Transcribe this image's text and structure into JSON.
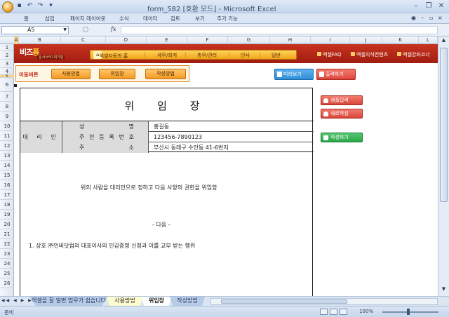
{
  "window": {
    "title": "form_582  [호환 모드] - Microsoft Excel"
  },
  "ribbon_tabs": [
    "홈",
    "삽입",
    "페이지 레이아웃",
    "수식",
    "데이터",
    "검토",
    "보기",
    "추가 기능"
  ],
  "formula_bar": {
    "name_box": "A5",
    "fx": "fx",
    "formula": ""
  },
  "columns": [
    "A",
    "B",
    "C",
    "D",
    "E",
    "F",
    "G",
    "H",
    "I",
    "J",
    "K",
    "L"
  ],
  "rows": [
    "1",
    "2",
    "3",
    "4",
    "5",
    "6",
    "7",
    "8",
    "9",
    "10",
    "11",
    "12",
    "13",
    "14",
    "15",
    "16",
    "17",
    "18",
    "19",
    "20",
    "21",
    "22",
    "23",
    "24",
    "25",
    "26"
  ],
  "banner": {
    "logo_a": "비즈",
    "logo_b": "폼",
    "logo_tag": "문서서식1위기업",
    "nav": [
      "엑셀자동화 홈",
      "세무/회계",
      "총무/관리",
      "인사",
      "일반"
    ],
    "links": [
      "엑셀FAQ",
      "엑셀지식컨텐츠",
      "엑셀강좌코너"
    ]
  },
  "move_bar": {
    "label": "이동버튼",
    "buttons": [
      "사용방법",
      "위임장",
      "작성방법"
    ]
  },
  "actions": {
    "preview": "미리보기",
    "print": "출력하기",
    "sample": "샘플입력",
    "new": "새로작성",
    "write": "작성하기"
  },
  "colors": {
    "banner": "#b52716",
    "nav": "#f2a51b",
    "preview": "#2f8fd8",
    "print": "#e0453a",
    "write": "#2aa84a"
  },
  "form": {
    "title": "위 임 장",
    "agent_label": "대 리 인",
    "fields": [
      {
        "key": [
          "성",
          "명"
        ],
        "value": "홍길동"
      },
      {
        "key": [
          "주",
          "민",
          "등",
          "록",
          "번",
          "호"
        ],
        "value": "123456-7890123"
      },
      {
        "key": [
          "주",
          "소"
        ],
        "value": "부산시 동래구 수안동 41-6번지"
      }
    ],
    "statement": "위의 사람을 대리인으로 정하고 다음 사항의 권한을 위임함",
    "next": "- 다음 -",
    "item1": "1. 상호 ㈜인비닷컴의 대표이사의 인감증명 신청과 이를 교부 받는 행위"
  },
  "sheet_tabs": [
    "엑셀을 잘 알면 업무가 쉽습니다",
    "사용방법",
    "위임장",
    "작성방법"
  ],
  "status": {
    "text": "준비",
    "zoom": "100%"
  }
}
